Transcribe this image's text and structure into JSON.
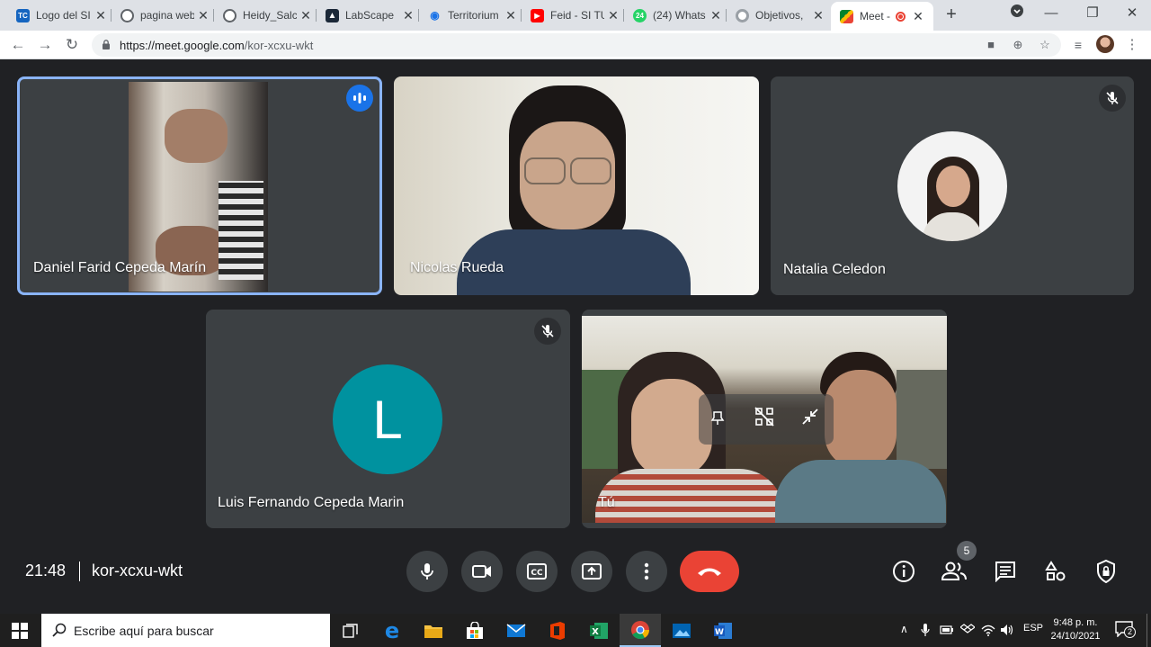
{
  "browser": {
    "tabs": [
      {
        "label": "Logo del SI",
        "favicon": "TC"
      },
      {
        "label": "pagina web",
        "favicon": ""
      },
      {
        "label": "Heidy_Salc",
        "favicon": ""
      },
      {
        "label": "LabScape",
        "favicon": ""
      },
      {
        "label": "Territorium",
        "favicon": ""
      },
      {
        "label": "Feid - SI TU",
        "favicon": ""
      },
      {
        "label": "(24) Whats",
        "favicon": "24"
      },
      {
        "label": "Objetivos,",
        "favicon": ""
      },
      {
        "label": "Meet -",
        "favicon": ""
      }
    ],
    "url_host": "https://meet.google.com",
    "url_path": "/kor-xcxu-wkt"
  },
  "participants": [
    {
      "name": "Daniel Farid Cepeda Marín"
    },
    {
      "name": "Nicolas Rueda"
    },
    {
      "name": "Natalia Celedon"
    },
    {
      "name": "Luis Fernando Cepeda Marin",
      "initial": "L"
    },
    {
      "name": "Tú"
    }
  ],
  "meeting": {
    "time": "21:48",
    "code": "kor-xcxu-wkt",
    "participant_count": "5"
  },
  "taskbar": {
    "search_placeholder": "Escribe aquí para buscar",
    "language": "ESP",
    "time": "9:48 p. m.",
    "date": "24/10/2021",
    "notifications": "2"
  },
  "colors": {
    "accent": "#8ab4f8",
    "hangup": "#ea4335",
    "avatar_teal": "#00929f",
    "speaking_blue": "#1a73e8"
  }
}
